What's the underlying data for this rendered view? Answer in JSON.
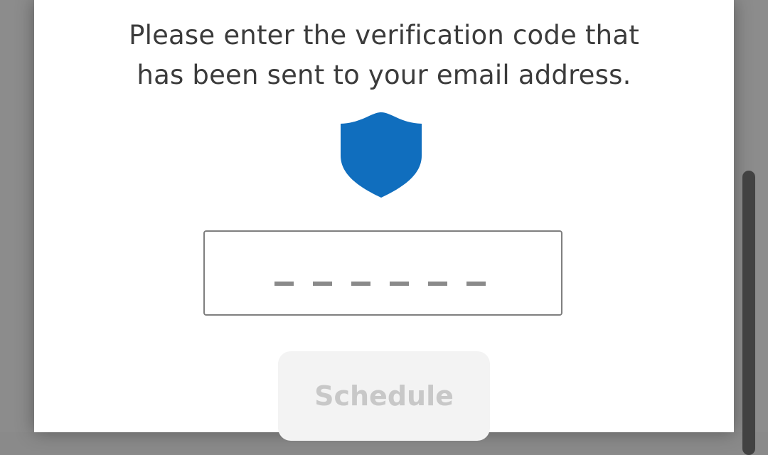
{
  "dialog": {
    "message_line1": "Please enter the verification code that",
    "message_line2": "has been sent to your email address.",
    "shield_icon": "shield-icon",
    "shield_color": "#106EBE"
  },
  "code_input": {
    "value": "",
    "placeholder_dashes": 6
  },
  "buttons": {
    "schedule_label": "Schedule"
  },
  "colors": {
    "background_overlay": "#8C8C8C",
    "dialog_bg": "#FFFFFF",
    "text": "#3B3B3B",
    "button_disabled_bg": "#F3F3F3",
    "button_disabled_text": "#C8C8C8"
  }
}
